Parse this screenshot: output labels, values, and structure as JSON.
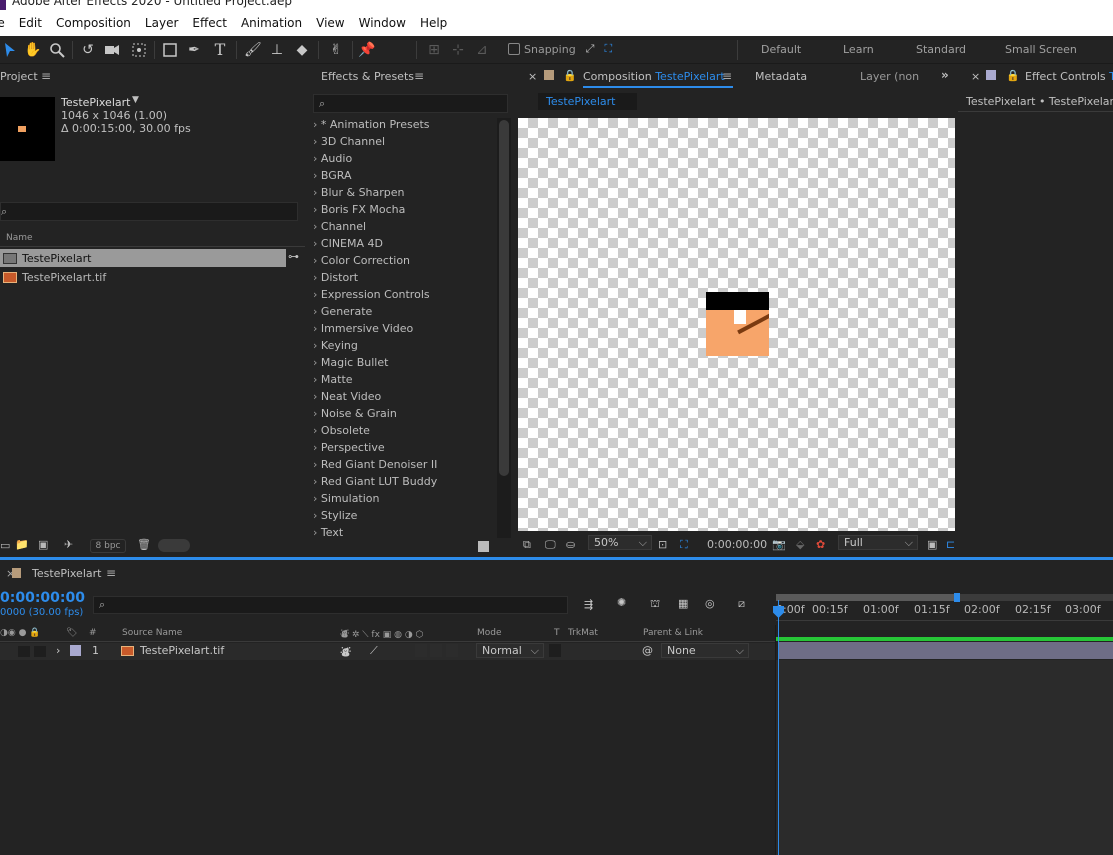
{
  "window": {
    "title": "Adobe After Effects 2020 - Untitled Project.aep"
  },
  "menu": [
    "le",
    "Edit",
    "Composition",
    "Layer",
    "Effect",
    "Animation",
    "View",
    "Window",
    "Help"
  ],
  "toolbar": {
    "snapping_label": "Snapping",
    "workspaces": [
      "Default",
      "Learn",
      "Standard",
      "Small Screen"
    ]
  },
  "project": {
    "tab_label": "Project",
    "comp_name": "TestePixelart",
    "comp_dims": "1046 x 1046 (1.00)",
    "comp_duration": "Δ 0:00:15:00, 30.00 fps",
    "search_placeholder": "",
    "col_name": "Name",
    "items": [
      {
        "name": "TestePixelart",
        "selected": true
      },
      {
        "name": "TestePixelart.tif",
        "selected": false
      }
    ],
    "bpc": "8 bpc"
  },
  "effects": {
    "tab_label": "Effects & Presets",
    "categories": [
      "* Animation Presets",
      "3D Channel",
      "Audio",
      "BGRA",
      "Blur & Sharpen",
      "Boris FX Mocha",
      "Channel",
      "CINEMA 4D",
      "Color Correction",
      "Distort",
      "Expression Controls",
      "Generate",
      "Immersive Video",
      "Keying",
      "Magic Bullet",
      "Matte",
      "Neat Video",
      "Noise & Grain",
      "Obsolete",
      "Perspective",
      "Red Giant Denoiser II",
      "Red Giant LUT Buddy",
      "Simulation",
      "Stylize",
      "Text"
    ]
  },
  "composition": {
    "tab_prefix": "Composition",
    "tab_name": "TestePixelart",
    "tab_metadata": "Metadata",
    "tab_layer": "Layer (non",
    "subtab": "TestePixelart",
    "zoom": "50%",
    "timecode": "0:00:00:00",
    "resolution": "Full"
  },
  "effect_controls": {
    "tab_label": "Effect Controls",
    "tab_suffix": "Te",
    "subtitle": "TestePixelart • TestePixelart.t"
  },
  "timeline": {
    "tab_label": "TestePixelart",
    "timecode": "0:00:00:00",
    "fps": "0000 (30.00 fps)",
    "col_hash": "#",
    "col_source": "Source Name",
    "col_mode": "Mode",
    "col_t": "T",
    "col_trkmat": "TrkMat",
    "col_parent": "Parent & Link",
    "layer": {
      "index": "1",
      "name": "TestePixelart.tif",
      "mode": "Normal",
      "parent": "None"
    },
    "ruler_ticks": [
      "0:00f",
      "00:15f",
      "01:00f",
      "01:15f",
      "02:00f",
      "02:15f",
      "03:00f"
    ]
  },
  "colors": {
    "accent": "#2d8ceb",
    "panel_bg": "#232323",
    "layer_bar": "#6e6d86",
    "green_bar": "#27c537",
    "art_orange": "#f7a56a"
  }
}
